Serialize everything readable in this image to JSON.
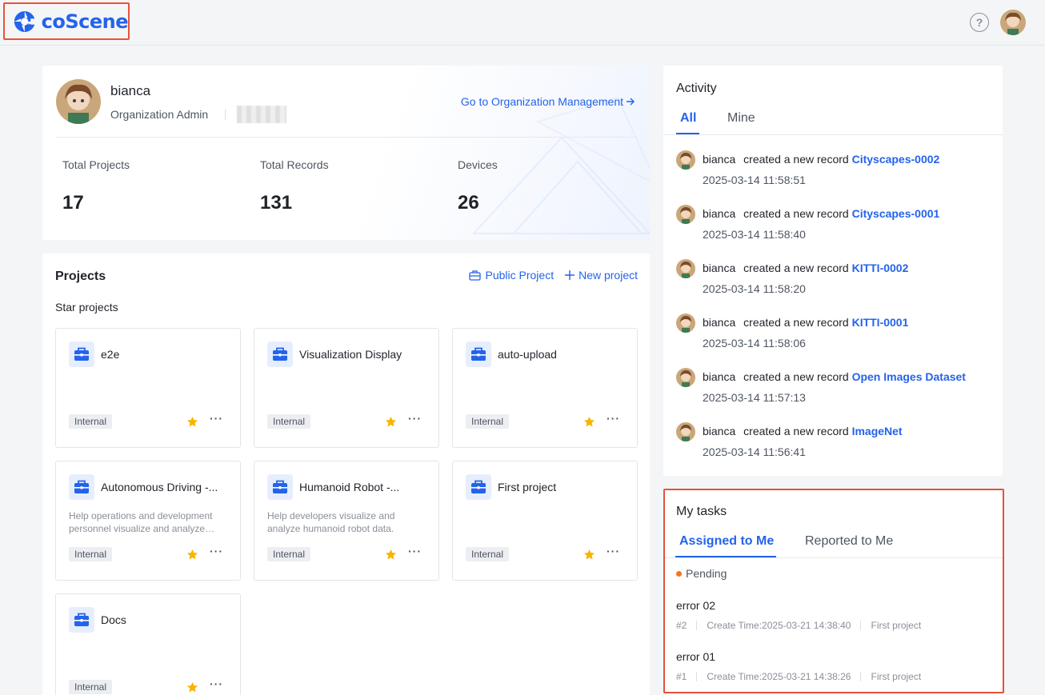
{
  "header": {
    "logo_text": "coScene",
    "help_icon": "question-circle-icon"
  },
  "profile": {
    "name": "bianca",
    "role": "Organization Admin",
    "manage_link": "Go to Organization Management",
    "stats": [
      {
        "label": "Total Projects",
        "value": "17"
      },
      {
        "label": "Total Records",
        "value": "131"
      },
      {
        "label": "Devices",
        "value": "26"
      }
    ]
  },
  "projects": {
    "title": "Projects",
    "public_project": "Public Project",
    "new_project": "New project",
    "star_title": "Star projects",
    "more_glyph": "···",
    "items": [
      {
        "name": "e2e",
        "desc": "",
        "tag": "Internal"
      },
      {
        "name": "Visualization Display",
        "desc": "",
        "tag": "Internal"
      },
      {
        "name": "auto-upload",
        "desc": "",
        "tag": "Internal"
      },
      {
        "name": "Autonomous Driving -...",
        "desc": "Help operations and development personnel visualize and analyze…",
        "tag": "Internal"
      },
      {
        "name": "Humanoid Robot -...",
        "desc": "Help developers visualize and analyze humanoid robot data.",
        "tag": "Internal"
      },
      {
        "name": "First project",
        "desc": "",
        "tag": "Internal"
      },
      {
        "name": "Docs",
        "desc": "",
        "tag": "Internal"
      }
    ]
  },
  "activity": {
    "title": "Activity",
    "tabs": [
      "All",
      "Mine"
    ],
    "items": [
      {
        "user": "bianca",
        "action": "created a new record",
        "record": "Cityscapes-0002",
        "time": "2025-03-14 11:58:51"
      },
      {
        "user": "bianca",
        "action": "created a new record",
        "record": "Cityscapes-0001",
        "time": "2025-03-14 11:58:40"
      },
      {
        "user": "bianca",
        "action": "created a new record",
        "record": "KITTI-0002",
        "time": "2025-03-14 11:58:20"
      },
      {
        "user": "bianca",
        "action": "created a new record",
        "record": "KITTI-0001",
        "time": "2025-03-14 11:58:06"
      },
      {
        "user": "bianca",
        "action": "created a new record",
        "record": "Open Images Dataset",
        "time": "2025-03-14 11:57:13"
      },
      {
        "user": "bianca",
        "action": "created a new record",
        "record": "ImageNet",
        "time": "2025-03-14 11:56:41"
      }
    ]
  },
  "tasks": {
    "title": "My tasks",
    "tabs": [
      "Assigned to Me",
      "Reported to Me"
    ],
    "status": "Pending",
    "items": [
      {
        "name": "error 02",
        "id": "#2",
        "created": "Create Time:2025-03-21 14:38:40",
        "project": "First project"
      },
      {
        "name": "error 01",
        "id": "#1",
        "created": "Create Time:2025-03-21 14:38:26",
        "project": "First project"
      }
    ]
  },
  "colors": {
    "accent": "#2463eb",
    "highlight_border": "#e8513b",
    "pending": "#f5761a",
    "star": "#f7b500"
  }
}
